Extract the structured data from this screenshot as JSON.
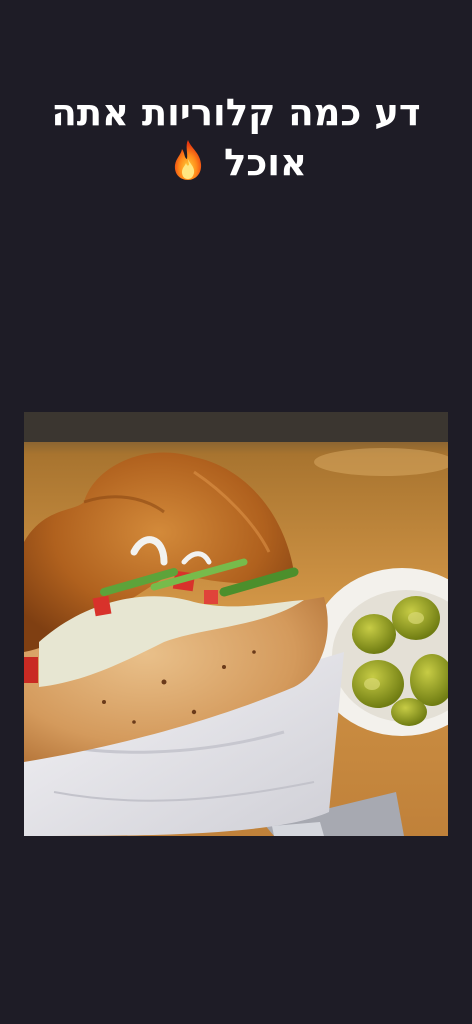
{
  "headline": {
    "line1": "דע כמה קלוריות אתה",
    "line2": "אוכל",
    "emoji_icon": "fire-icon"
  },
  "photo": {
    "subject": "food-photo",
    "colors": {
      "background": "#1e1c26",
      "table": "#c98a3e",
      "pita": "#d9a669",
      "schnitzel": "#b8661f",
      "paper": "#ecebee",
      "pickles": "#8a9a1c"
    }
  }
}
